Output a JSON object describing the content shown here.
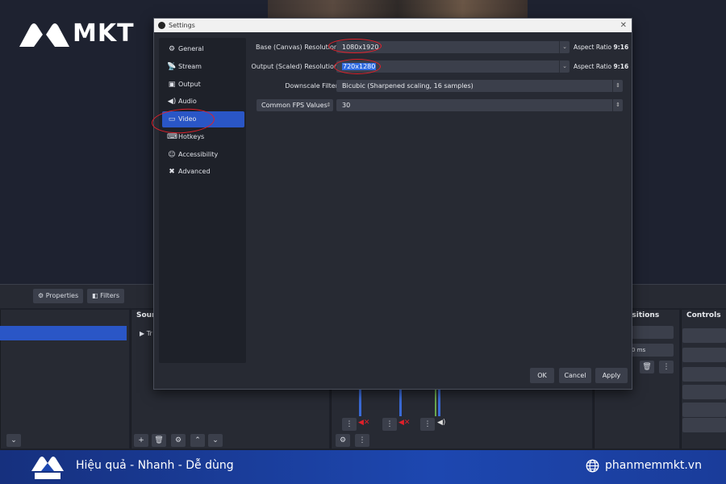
{
  "brand": {
    "name": "MKT",
    "slogan": "Hiệu quả - Nhanh - Dễ dùng",
    "website": "phanmemmkt.vn"
  },
  "background": {
    "properties_label": "Properties",
    "filters_label": "Filters",
    "sources_title": "Sour",
    "transitions_title": "nsitions",
    "controls_title": "Controls",
    "duration_value": "0 ms",
    "source_item": "Tr"
  },
  "dialog": {
    "title": "Settings",
    "nav": [
      {
        "label": "General",
        "icon": "gear-icon"
      },
      {
        "label": "Stream",
        "icon": "antenna-icon"
      },
      {
        "label": "Output",
        "icon": "output-icon"
      },
      {
        "label": "Audio",
        "icon": "speaker-icon"
      },
      {
        "label": "Video",
        "icon": "monitor-icon"
      },
      {
        "label": "Hotkeys",
        "icon": "keyboard-icon"
      },
      {
        "label": "Accessibility",
        "icon": "accessibility-icon"
      },
      {
        "label": "Advanced",
        "icon": "tools-icon"
      }
    ],
    "active_nav": "Video",
    "video": {
      "base_label": "Base (Canvas) Resolution",
      "base_value": "1080x1920",
      "base_aspect_prefix": "Aspect Ratio",
      "base_aspect": "9:16",
      "output_label": "Output (Scaled) Resolution",
      "output_value": "720x1280",
      "output_aspect_prefix": "Aspect Ratio",
      "output_aspect": "9:16",
      "downscale_label": "Downscale Filter",
      "downscale_value": "Bicubic (Sharpened scaling, 16 samples)",
      "fps_type": "Common FPS Values",
      "fps_value": "30"
    },
    "buttons": {
      "ok": "OK",
      "cancel": "Cancel",
      "apply": "Apply"
    }
  },
  "colors": {
    "accent": "#2a56c6",
    "annotation": "#e0202a",
    "banner": "#1d47b0"
  }
}
